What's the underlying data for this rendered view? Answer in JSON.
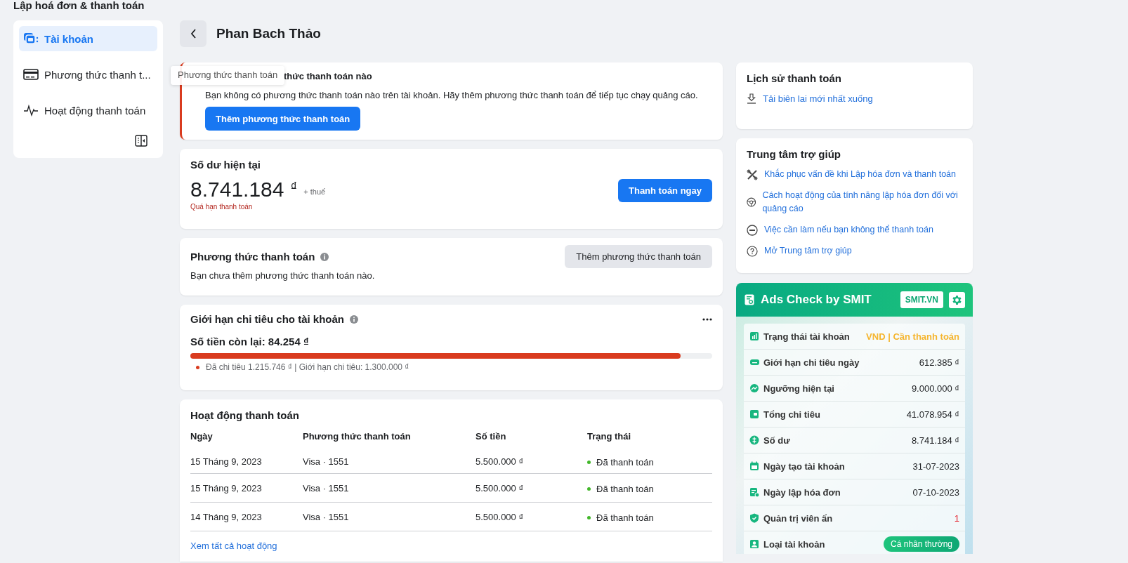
{
  "page_title": "Lập hoá đơn & thanh toán",
  "sidebar": {
    "items": [
      {
        "label": "Tài khoản",
        "selected": true
      },
      {
        "label": "Phương thức thanh t...",
        "selected": false
      },
      {
        "label": "Hoạt động thanh toán",
        "selected": false
      }
    ]
  },
  "header": {
    "title": "Phan Bach Thảo"
  },
  "tooltip": "Phương thức thanh toán",
  "alert": {
    "title": "thức thanh toán nào",
    "message": "Bạn không có phương thức thanh toán nào trên tài khoản. Hãy thêm phương thức thanh toán để tiếp tục chạy quảng cáo.",
    "button": "Thêm phương thức thanh toán"
  },
  "balance": {
    "title": "Số dư hiện tại",
    "amount": "8.741.184",
    "currency": "₫",
    "tax": "+ thuế",
    "overdue": "Quá hạn thanh toán",
    "button": "Thanh toán ngay"
  },
  "payment_methods": {
    "title": "Phương thức thanh toán",
    "button": "Thêm phương thức thanh toán",
    "message": "Bạn chưa thêm phương thức thanh toán nào."
  },
  "spending_limit": {
    "title": "Giới hạn chi tiêu cho tài khoản",
    "remaining": "Số tiền còn lại: 84.254 ₫",
    "level": 0.94,
    "legend": "Đã chi tiêu 1.215.746 ₫ | Giới hạn chi tiêu: 1.300.000 ₫",
    "color": "#d93b1f"
  },
  "activity": {
    "title": "Hoạt động thanh toán",
    "columns": [
      "Ngày",
      "Phương thức thanh toán",
      "Số tiền",
      "Trạng thái"
    ],
    "rows": [
      {
        "date": "15 Tháng 9, 2023",
        "method": "Visa · 1551",
        "amount": "5.500.000 ₫",
        "status": "Đã thanh toán",
        "color": "#42b72a"
      },
      {
        "date": "15 Tháng 9, 2023",
        "method": "Visa · 1551",
        "amount": "5.500.000 ₫",
        "status": "Đã thanh toán",
        "color": "#42b72a"
      },
      {
        "date": "14 Tháng 9, 2023",
        "method": "Visa · 1551",
        "amount": "5.500.000 ₫",
        "status": "Đã thanh toán",
        "color": "#42b72a"
      }
    ],
    "link": "Xem tất cả hoạt động"
  },
  "history": {
    "title": "Lịch sử thanh toán",
    "link": "Tải biên lai mới nhất xuống"
  },
  "help": {
    "title": "Trung tâm trợ giúp",
    "links": [
      "Khắc phục vấn đề khi Lập hóa đơn và thanh toán",
      "Cách hoạt động của tính năng lập hóa đơn đối với quảng cáo",
      "Việc cần làm nếu bạn không thể thanh toán",
      "Mở Trung tâm trợ giúp"
    ]
  },
  "ads_check": {
    "title": "Ads Check by SMIT",
    "site_button": "SMIT.VN",
    "rows": [
      {
        "label": "Trạng thái tài khoản",
        "value": "VND | Cần thanh toán",
        "kind": "warning"
      },
      {
        "label": "Giới hạn chi tiêu ngày",
        "value": "612.385 ₫",
        "kind": "plain"
      },
      {
        "label": "Ngưỡng hiện tại",
        "value": "9.000.000 ₫",
        "kind": "plain"
      },
      {
        "label": "Tổng chi tiêu",
        "value": "41.078.954 ₫",
        "kind": "plain"
      },
      {
        "label": "Số dư",
        "value": "8.741.184 ₫",
        "kind": "plain"
      },
      {
        "label": "Ngày tạo tài khoản",
        "value": "31-07-2023",
        "kind": "plain"
      },
      {
        "label": "Ngày lập hóa đơn",
        "value": "07-10-2023",
        "kind": "plain"
      },
      {
        "label": "Quản trị viên ẩn",
        "value": "1",
        "kind": "alert"
      },
      {
        "label": "Loại tài khoản",
        "value": "Cá nhân thường",
        "kind": "badge"
      }
    ]
  }
}
